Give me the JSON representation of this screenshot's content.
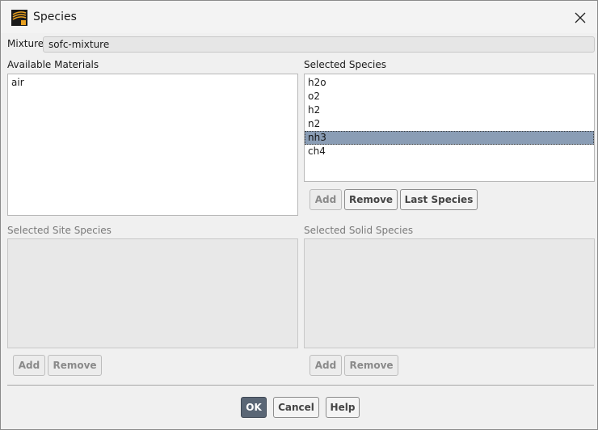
{
  "window": {
    "title": "Species",
    "close_icon": "close-icon"
  },
  "mixture": {
    "label": "Mixture",
    "value": "sofc-mixture"
  },
  "available_materials": {
    "label": "Available Materials",
    "items": [
      "air"
    ]
  },
  "selected_species": {
    "label": "Selected Species",
    "items": [
      "h2o",
      "o2",
      "h2",
      "n2",
      "nh3",
      "ch4"
    ],
    "selected": "nh3",
    "buttons": {
      "add": "Add",
      "remove": "Remove",
      "last": "Last Species"
    }
  },
  "site_species": {
    "label": "Selected Site Species",
    "buttons": {
      "add": "Add",
      "remove": "Remove"
    }
  },
  "solid_species": {
    "label": "Selected Solid Species",
    "buttons": {
      "add": "Add",
      "remove": "Remove"
    }
  },
  "footer": {
    "ok": "OK",
    "cancel": "Cancel",
    "help": "Help"
  },
  "colors": {
    "selection": "#8a9db5",
    "ok_button": "#5a6675",
    "app_icon_bg": "#1a1a1a",
    "app_icon_accent": "#e8a020"
  }
}
